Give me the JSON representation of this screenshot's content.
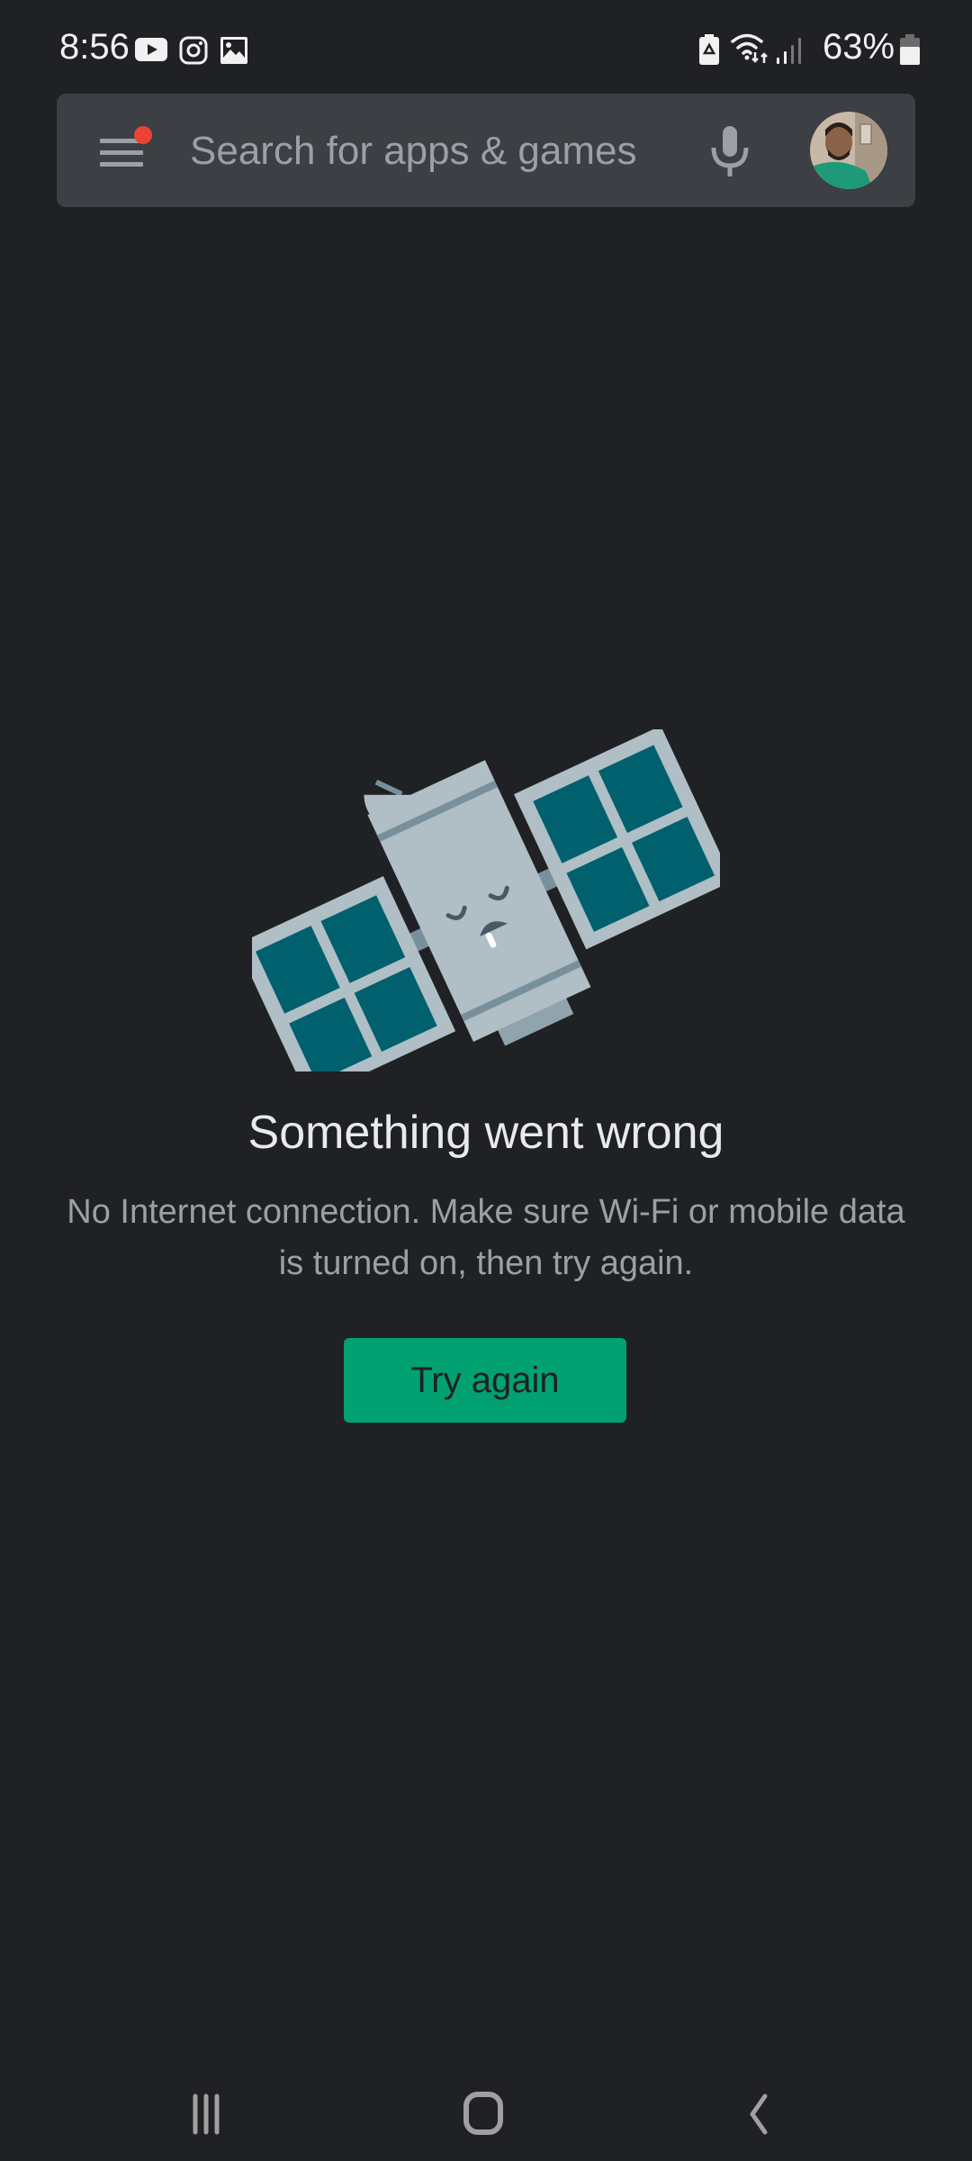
{
  "status_bar": {
    "time": "8:56",
    "notification_icons": [
      "youtube-icon",
      "instagram-icon",
      "gallery-icon"
    ],
    "system_icons": [
      "battery-saver-icon",
      "wifi-icon",
      "signal-icon"
    ],
    "battery_percent": "63%"
  },
  "search": {
    "placeholder": "Search for apps & games",
    "menu_has_notification": true,
    "notification_dot_color": "#ea4335"
  },
  "error": {
    "title": "Something went wrong",
    "message": "No Internet connection. Make sure Wi-Fi or mobile data is turned on, then try again.",
    "illustration": "sleeping-satellite",
    "retry_label": "Try again",
    "retry_color": "#01a172"
  },
  "nav_bar": {
    "buttons": [
      "recents",
      "home",
      "back"
    ]
  },
  "colors": {
    "background": "#202124",
    "search_bg": "#3c3f43",
    "panel_frame": "#b0bec5",
    "panel_cell": "#00606e",
    "arm": "#78909c"
  }
}
